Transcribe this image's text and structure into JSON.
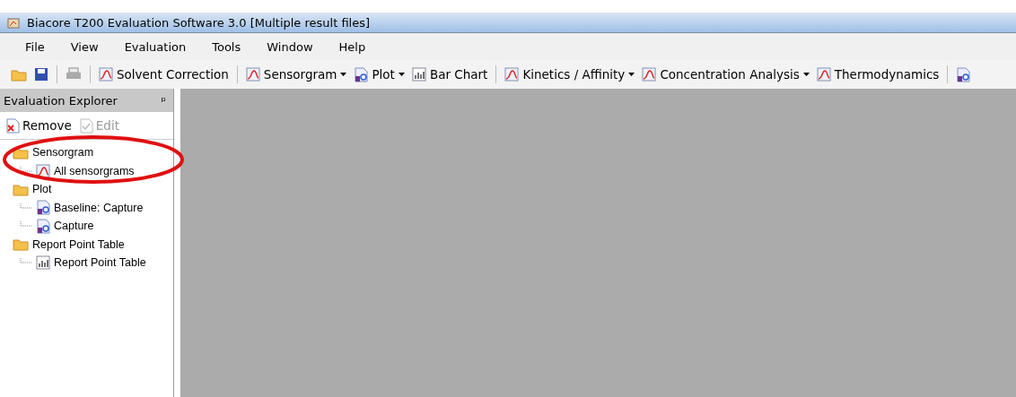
{
  "window": {
    "title": "Biacore T200 Evaluation Software 3.0 [Multiple result files]"
  },
  "menu": [
    "File",
    "View",
    "Evaluation",
    "Tools",
    "Window",
    "Help"
  ],
  "toolbar": [
    {
      "kind": "open"
    },
    {
      "kind": "save"
    },
    {
      "kind": "separator"
    },
    {
      "kind": "print"
    },
    {
      "kind": "separator"
    },
    {
      "kind": "chart",
      "label": "Solvent Correction",
      "dropdown": false
    },
    {
      "kind": "separator"
    },
    {
      "kind": "chart",
      "label": "Sensorgram",
      "dropdown": true
    },
    {
      "kind": "plot",
      "label": "Plot",
      "dropdown": true
    },
    {
      "kind": "bars",
      "label": "Bar Chart",
      "dropdown": false
    },
    {
      "kind": "separator"
    },
    {
      "kind": "chart",
      "label": "Kinetics / Affinity",
      "dropdown": true
    },
    {
      "kind": "chart",
      "label": "Concentration Analysis",
      "dropdown": true
    },
    {
      "kind": "chart",
      "label": "Thermodynamics",
      "dropdown": false
    },
    {
      "kind": "separator"
    },
    {
      "kind": "plot-cut"
    }
  ],
  "explorer": {
    "title": "Evaluation Explorer",
    "pin": "ᵖ",
    "actions": [
      {
        "label": "Remove",
        "kind": "remove",
        "disabled": false
      },
      {
        "label": "Edit",
        "kind": "edit",
        "disabled": true
      }
    ],
    "tree": [
      {
        "label": "Sensorgram",
        "kind": "folder",
        "children": [
          {
            "label": "All sensorgrams",
            "kind": "sensorgram"
          }
        ]
      },
      {
        "label": "Plot",
        "kind": "folder",
        "children": [
          {
            "label": "Baseline: Capture",
            "kind": "plot"
          },
          {
            "label": "Capture",
            "kind": "plot"
          }
        ]
      },
      {
        "label": "Report Point Table",
        "kind": "folder",
        "children": [
          {
            "label": "Report Point Table",
            "kind": "table"
          }
        ]
      }
    ]
  }
}
